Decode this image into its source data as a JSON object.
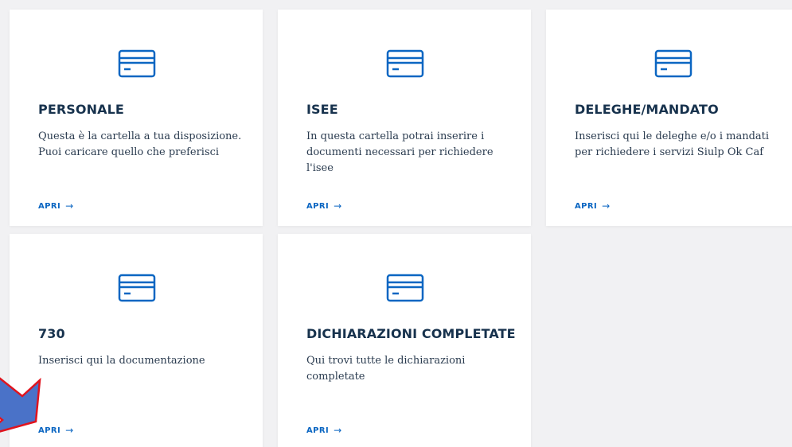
{
  "cards": [
    {
      "icon": "credit-card-icon",
      "title": "PERSONALE",
      "description": "Questa è la cartella a tua disposizione. Puoi caricare quello che preferisci",
      "link_label": "APRI",
      "link_arrow": "→"
    },
    {
      "icon": "credit-card-icon",
      "title": "ISEE",
      "description": "In questa cartella potrai inserire i documenti necessari per richiedere l'isee",
      "link_label": "APRI",
      "link_arrow": "→"
    },
    {
      "icon": "credit-card-icon",
      "title": "DELEGHE/MANDATO",
      "description": "Inserisci qui le deleghe e/o i mandati per richiedere i servizi Siulp Ok Caf",
      "link_label": "APRI",
      "link_arrow": "→"
    },
    {
      "icon": "credit-card-icon",
      "title": "730",
      "description": "Inserisci qui la documentazione",
      "link_label": "APRI",
      "link_arrow": "→"
    },
    {
      "icon": "credit-card-icon",
      "title": "DICHIARAZIONI COMPLETATE",
      "description": "Qui trovi tutte le dichiarazioni completate",
      "link_label": "APRI",
      "link_arrow": "→"
    }
  ],
  "annotation": {
    "icon": "arrow-pointer-icon",
    "fill_color": "#4a72c8",
    "stroke_color": "#e0141e"
  },
  "colors": {
    "accent": "#0b66c2",
    "title": "#17324d",
    "background": "#f1f1f3"
  }
}
